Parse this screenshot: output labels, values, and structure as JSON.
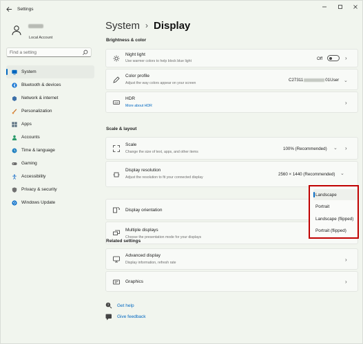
{
  "window": {
    "title": "Settings"
  },
  "profile": {
    "account_type": "Local Account"
  },
  "search": {
    "placeholder": "Find a setting"
  },
  "sidebar": {
    "items": [
      {
        "label": "System",
        "icon": "monitor-icon",
        "active": true,
        "color": "#0067c0"
      },
      {
        "label": "Bluetooth & devices",
        "icon": "bluetooth-icon",
        "color": "#0a6ed1"
      },
      {
        "label": "Network & internet",
        "icon": "network-icon",
        "color": "#3d6fa8"
      },
      {
        "label": "Personalization",
        "icon": "brush-icon",
        "color": "#c8742a"
      },
      {
        "label": "Apps",
        "icon": "apps-icon",
        "color": "#556b7d"
      },
      {
        "label": "Accounts",
        "icon": "person-icon",
        "color": "#2a9a6a"
      },
      {
        "label": "Time & language",
        "icon": "globe-clock-icon",
        "color": "#1f7fbf"
      },
      {
        "label": "Gaming",
        "icon": "gamepad-icon",
        "color": "#6d6d6d"
      },
      {
        "label": "Accessibility",
        "icon": "accessibility-icon",
        "color": "#1b6fc9"
      },
      {
        "label": "Privacy & security",
        "icon": "shield-icon",
        "color": "#717171"
      },
      {
        "label": "Windows Update",
        "icon": "update-icon",
        "color": "#0b6fc9"
      }
    ]
  },
  "breadcrumb": {
    "parent": "System",
    "separator": "›",
    "current": "Display"
  },
  "sections": {
    "brightness": "Brightness & color",
    "scale": "Scale & layout",
    "related": "Related settings"
  },
  "night_light": {
    "title": "Night light",
    "subtitle": "Use warmer colors to help block blue light",
    "state": "Off"
  },
  "color_profile": {
    "title": "Color profile",
    "subtitle": "Adjust the way colors appear on your screen",
    "value_prefix": "C27311",
    "value_suffix": "01User"
  },
  "hdr": {
    "title": "HDR",
    "link": "More about HDR"
  },
  "scale": {
    "title": "Scale",
    "subtitle": "Change the size of text, apps, and other items",
    "value": "100% (Recommended)"
  },
  "resolution": {
    "title": "Display resolution",
    "subtitle": "Adjust the resolution to fit your connected display",
    "value": "2560 × 1440 (Recommended)"
  },
  "orientation": {
    "title": "Display orientation"
  },
  "multiple_displays": {
    "title": "Multiple displays",
    "subtitle": "Choose the presentation mode for your displays"
  },
  "orientation_menu": {
    "options": [
      "Landscape",
      "Portrait",
      "Landscape (flipped)",
      "Portrait (flipped)"
    ],
    "selected": "Landscape"
  },
  "advanced_display": {
    "title": "Advanced display",
    "subtitle": "Display information, refresh rate"
  },
  "graphics": {
    "title": "Graphics"
  },
  "help": {
    "get_help": "Get help",
    "feedback": "Give feedback"
  },
  "accent_color": "#0067c0",
  "highlight_color": "#c00000"
}
